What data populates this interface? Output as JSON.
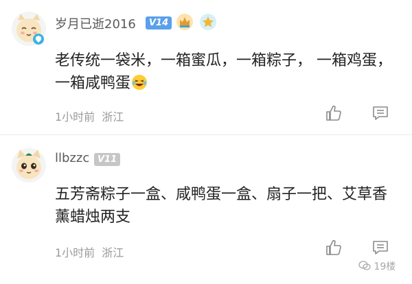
{
  "comments": [
    {
      "username": "岁月已逝2016",
      "level": "V14",
      "content": "老传统一袋米，一箱蜜瓜，一箱粽子， 一箱鸡蛋，一箱咸鸭蛋",
      "has_emoji": "laughing-emoji",
      "time": "1小时前",
      "location": "浙江",
      "avatar_icon": "cat-avatar-with-shield-badge",
      "medals": [
        "medal-icon",
        "medal-icon"
      ]
    },
    {
      "username": "llbzzc",
      "level": "V11",
      "content": "五芳斋粽子一盒、咸鸭蛋一盒、扇子一把、艾草香薰蜡烛两支",
      "time": "1小时前",
      "location": "浙江",
      "avatar_icon": "cat-avatar"
    }
  ],
  "actions": {
    "like_icon": "thumbs-up-icon",
    "reply_icon": "comment-icon"
  },
  "watermark": "19楼",
  "colors": {
    "level_v14": "#5aa0ea",
    "level_v11": "#c6c6c6",
    "meta_text": "#9a9a9a"
  }
}
